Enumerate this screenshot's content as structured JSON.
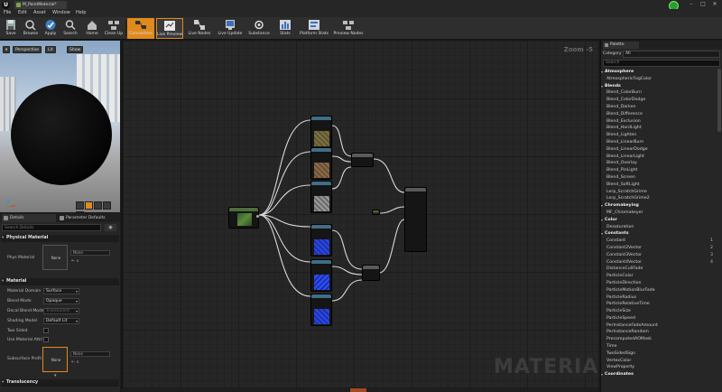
{
  "app": {
    "doc_tab": "M_PaintMaterial*",
    "window_buttons": [
      "–",
      "□",
      "✕"
    ]
  },
  "menu": [
    "File",
    "Edit",
    "Asset",
    "Window",
    "Help"
  ],
  "toolbar": [
    {
      "label": "Save",
      "icon": "save-icon"
    },
    {
      "label": "Browse",
      "icon": "browse-icon"
    },
    {
      "label": "Apply",
      "icon": "apply-icon"
    },
    {
      "label": "Search",
      "icon": "search-icon"
    },
    {
      "label": "Home",
      "icon": "home-icon"
    },
    {
      "label": "Clean Up",
      "icon": "clean-up-icon"
    },
    {
      "label": "Connectors",
      "icon": "connectors-icon",
      "active": true
    },
    {
      "label": "Live Preview",
      "icon": "live-preview-icon",
      "active": true
    },
    {
      "label": "Live Nodes",
      "icon": "live-nodes-icon"
    },
    {
      "label": "Live Update",
      "icon": "live-update-icon"
    },
    {
      "label": "Substance",
      "icon": "substance-icon"
    },
    {
      "label": "Stats",
      "icon": "stats-icon"
    },
    {
      "label": "Platform Stats",
      "icon": "platform-stats-icon"
    },
    {
      "label": "Preview Nodes",
      "icon": "preview-nodes-icon"
    }
  ],
  "viewport": {
    "perspective": "Perspective",
    "lit": "Lit",
    "show": "Show"
  },
  "details": {
    "tab_details": "Details",
    "tab_param": "Parameter Defaults",
    "search_placeholder": "Search Details",
    "physical_material": {
      "category": "Physical Material",
      "phys_label": "Phys Material",
      "thumb_text": "None",
      "dd_text": "None"
    },
    "material": {
      "category": "Material",
      "rows": [
        {
          "label": "Material Domain",
          "value": "Surface"
        },
        {
          "label": "Blend Mode",
          "value": "Opaque"
        },
        {
          "label": "Decal Blend Mode",
          "value": "Translucent"
        },
        {
          "label": "Shading Model",
          "value": "Default Lit"
        }
      ],
      "two_sided": "Two Sided",
      "use_attr": "Use Material Attri",
      "subsurface": "Subsurface Profil",
      "subsurface_thumb": "None",
      "subsurface_dd": "None"
    },
    "translucency": "Translucency"
  },
  "graph": {
    "zoom": "Zoom -5",
    "watermark": "MATERIAL"
  },
  "palette": {
    "tab": "Palette",
    "category_label": "Category",
    "category_value": "All",
    "search_placeholder": "Search",
    "items": [
      {
        "t": "Atmosphere",
        "cat": true
      },
      {
        "t": "AtmosphericFogColor"
      },
      {
        "t": "Blends",
        "cat": true
      },
      {
        "t": "Blend_ColorBurn"
      },
      {
        "t": "Blend_ColorDodge"
      },
      {
        "t": "Blend_Darken"
      },
      {
        "t": "Blend_Difference"
      },
      {
        "t": "Blend_Exclusion"
      },
      {
        "t": "Blend_HardLight"
      },
      {
        "t": "Blend_Lighten"
      },
      {
        "t": "Blend_LinearBurn"
      },
      {
        "t": "Blend_LinearDodge"
      },
      {
        "t": "Blend_LinearLight"
      },
      {
        "t": "Blend_Overlay"
      },
      {
        "t": "Blend_PinLight"
      },
      {
        "t": "Blend_Screen"
      },
      {
        "t": "Blend_SoftLight"
      },
      {
        "t": "Lerp_ScratchGrime"
      },
      {
        "t": "Lerp_ScratchGrime2"
      },
      {
        "t": "Chromakeying",
        "cat": true
      },
      {
        "t": "MF_Chromakeyer"
      },
      {
        "t": "Color",
        "cat": true
      },
      {
        "t": "Desaturation"
      },
      {
        "t": "Constants",
        "cat": true
      },
      {
        "t": "Constant",
        "sc": "1"
      },
      {
        "t": "Constant2Vector",
        "sc": "2"
      },
      {
        "t": "Constant3Vector",
        "sc": "3"
      },
      {
        "t": "Constant4Vector",
        "sc": "4"
      },
      {
        "t": "DistanceCullFade"
      },
      {
        "t": "ParticleColor"
      },
      {
        "t": "ParticleDirection"
      },
      {
        "t": "ParticleMotionBlurFade"
      },
      {
        "t": "ParticleRadius"
      },
      {
        "t": "ParticleRelativeTime"
      },
      {
        "t": "ParticleSize"
      },
      {
        "t": "ParticleSpeed"
      },
      {
        "t": "PerInstanceFadeAmount"
      },
      {
        "t": "PerInstanceRandom"
      },
      {
        "t": "PrecomputedAOMask"
      },
      {
        "t": "Time"
      },
      {
        "t": "TwoSidedSign"
      },
      {
        "t": "VertexColor"
      },
      {
        "t": "ViewProperty"
      },
      {
        "t": "Coordinates",
        "cat": true
      }
    ]
  }
}
